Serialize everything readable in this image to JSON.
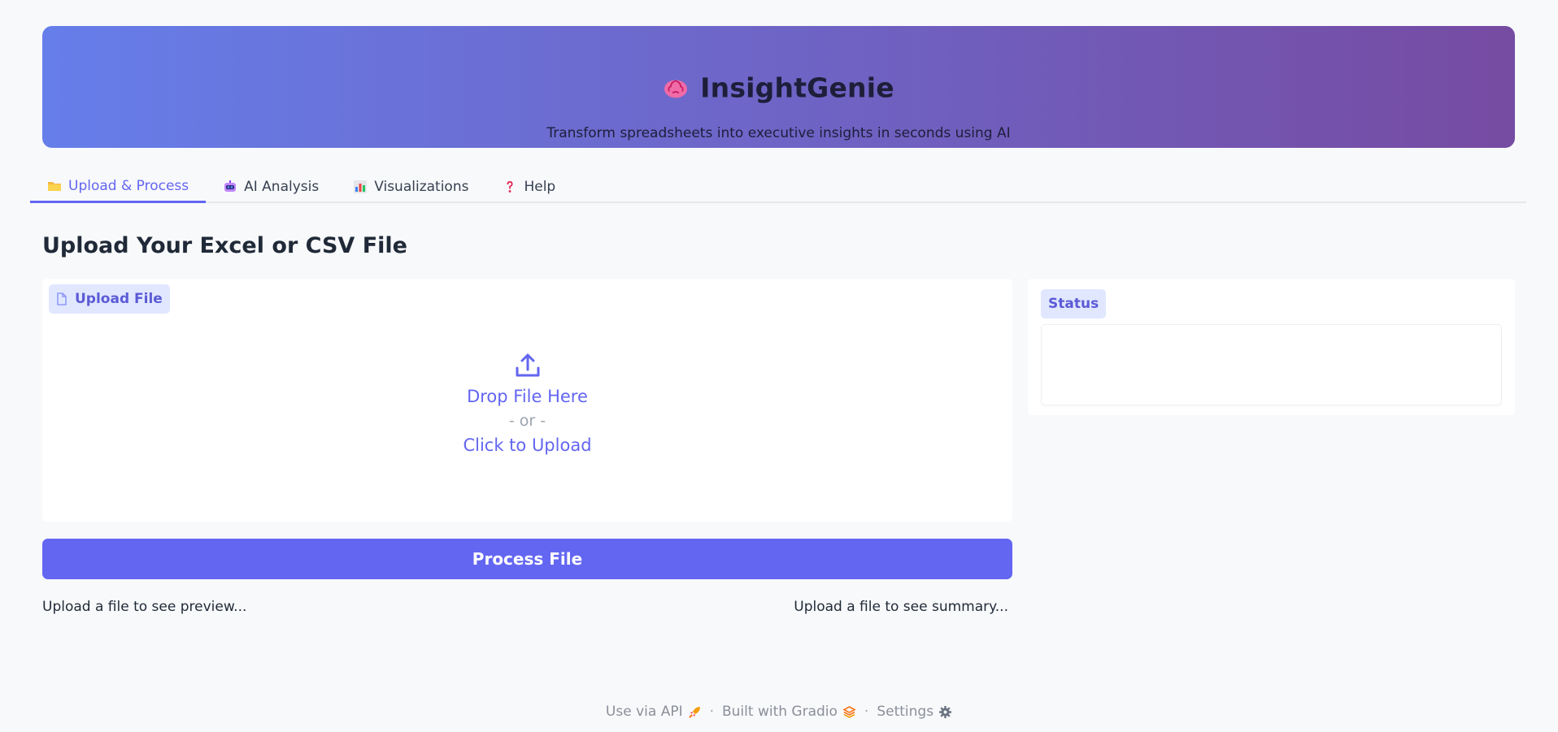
{
  "header": {
    "title": "InsightGenie",
    "subtitle": "Transform spreadsheets into executive insights in seconds using AI",
    "logo_icon": "brain-icon",
    "gradient": [
      "#667eea",
      "#764ba2"
    ]
  },
  "tabs": [
    {
      "label": "Upload & Process",
      "icon": "folder-icon",
      "active": true
    },
    {
      "label": "AI Analysis",
      "icon": "robot-icon",
      "active": false
    },
    {
      "label": "Visualizations",
      "icon": "bar-chart-icon",
      "active": false
    },
    {
      "label": "Help",
      "icon": "question-icon",
      "active": false
    }
  ],
  "main": {
    "heading": "Upload Your Excel or CSV File",
    "upload": {
      "label": "Upload File",
      "drop_text": "Drop File Here",
      "or_text": "- or -",
      "click_text": "Click to Upload"
    },
    "status": {
      "label": "Status",
      "value": ""
    },
    "process_button": "Process File",
    "preview_placeholder": "Upload a file to see preview...",
    "summary_placeholder": "Upload a file to see summary..."
  },
  "footer": {
    "api_link": "Use via API",
    "built_with": "Built with Gradio",
    "settings": "Settings",
    "separator": "·"
  },
  "colors": {
    "accent": "#6366f1",
    "pill_bg": "#e0e7ff",
    "background": "#f8f9fb"
  }
}
